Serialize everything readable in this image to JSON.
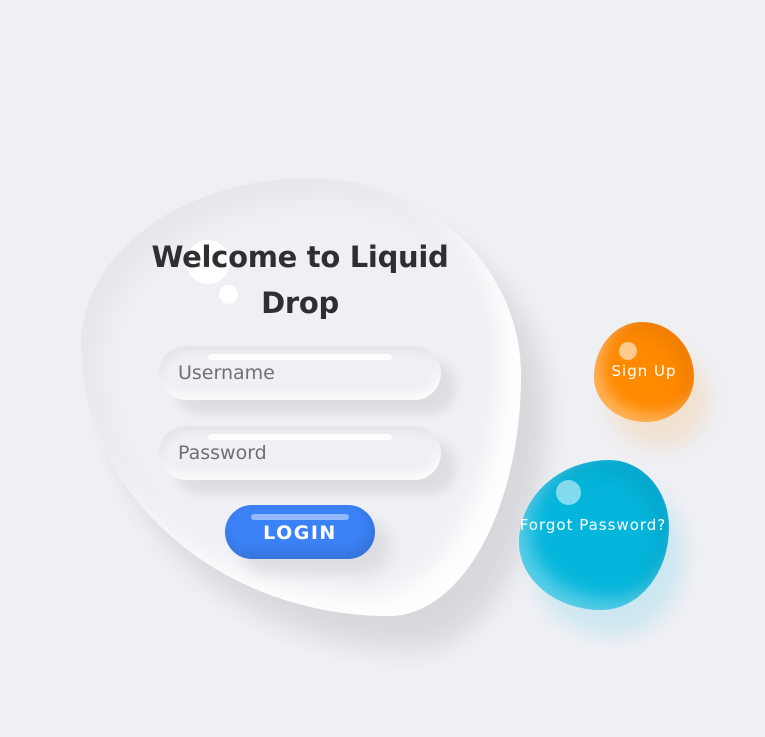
{
  "login_card": {
    "title": "Welcome to Liquid Drop",
    "username": {
      "placeholder": "Username",
      "value": ""
    },
    "password": {
      "placeholder": "Password",
      "value": ""
    },
    "login_label": "LOGIN"
  },
  "side_actions": {
    "signup_label": "Sign Up",
    "forgot_label": "Forgot Password?"
  },
  "colors": {
    "background": "#eff0f4",
    "login_button": "#3b82f6",
    "signup_drop": "#ff8a00",
    "forgot_drop": "#05b6dc",
    "title_text": "#2f2f33"
  }
}
